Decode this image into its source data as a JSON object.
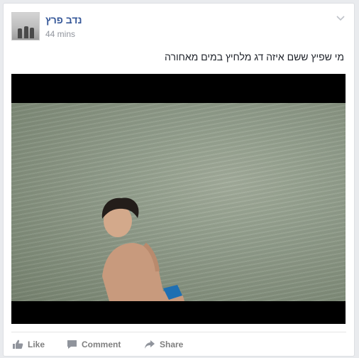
{
  "post": {
    "author": "נדב פרץ",
    "time": "44 mins",
    "text": "מי שפיץ ששם איזה דג מלחיץ במים מאחורה"
  },
  "actions": {
    "like": "Like",
    "comment": "Comment",
    "share": "Share"
  },
  "icons": {
    "options": "chevron-down-icon",
    "like": "thumbs-up-icon",
    "comment": "speech-bubble-icon",
    "share": "share-arrow-icon"
  },
  "colors": {
    "author": "#365899",
    "meta": "#90949c",
    "action": "#7f7f7f"
  }
}
